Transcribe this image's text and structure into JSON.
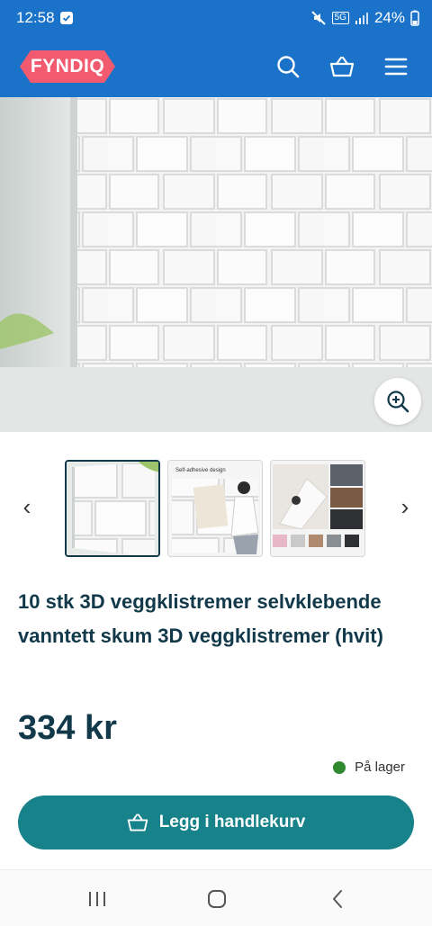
{
  "status_bar": {
    "time": "12:58",
    "battery": "24%",
    "network": "5G"
  },
  "header": {
    "logo": "FYNDIQ"
  },
  "product": {
    "title": "10 stk 3D veggklistremer selvklebende vanntett skum 3D veggklistremer (hvit)",
    "price": "334 kr",
    "stock": "På lager",
    "add_to_cart": "Legg i handlekurv",
    "thumbnail_caption": "Self-adhesive design"
  },
  "gallery": {
    "prev": "‹",
    "next": "›",
    "thumbnail_count": 3,
    "active_index": 0
  },
  "colors": {
    "header_blue": "#1a73c8",
    "logo_pink": "#f25a6f",
    "primary_dark": "#11394a",
    "cart_teal": "#17828a",
    "stock_green": "#2f8a2f"
  },
  "icons": [
    "search-icon",
    "basket-icon",
    "menu-icon",
    "zoom-in-icon",
    "chevron-left-icon",
    "chevron-right-icon",
    "cart-icon",
    "recent-apps-icon",
    "home-icon",
    "back-icon"
  ]
}
